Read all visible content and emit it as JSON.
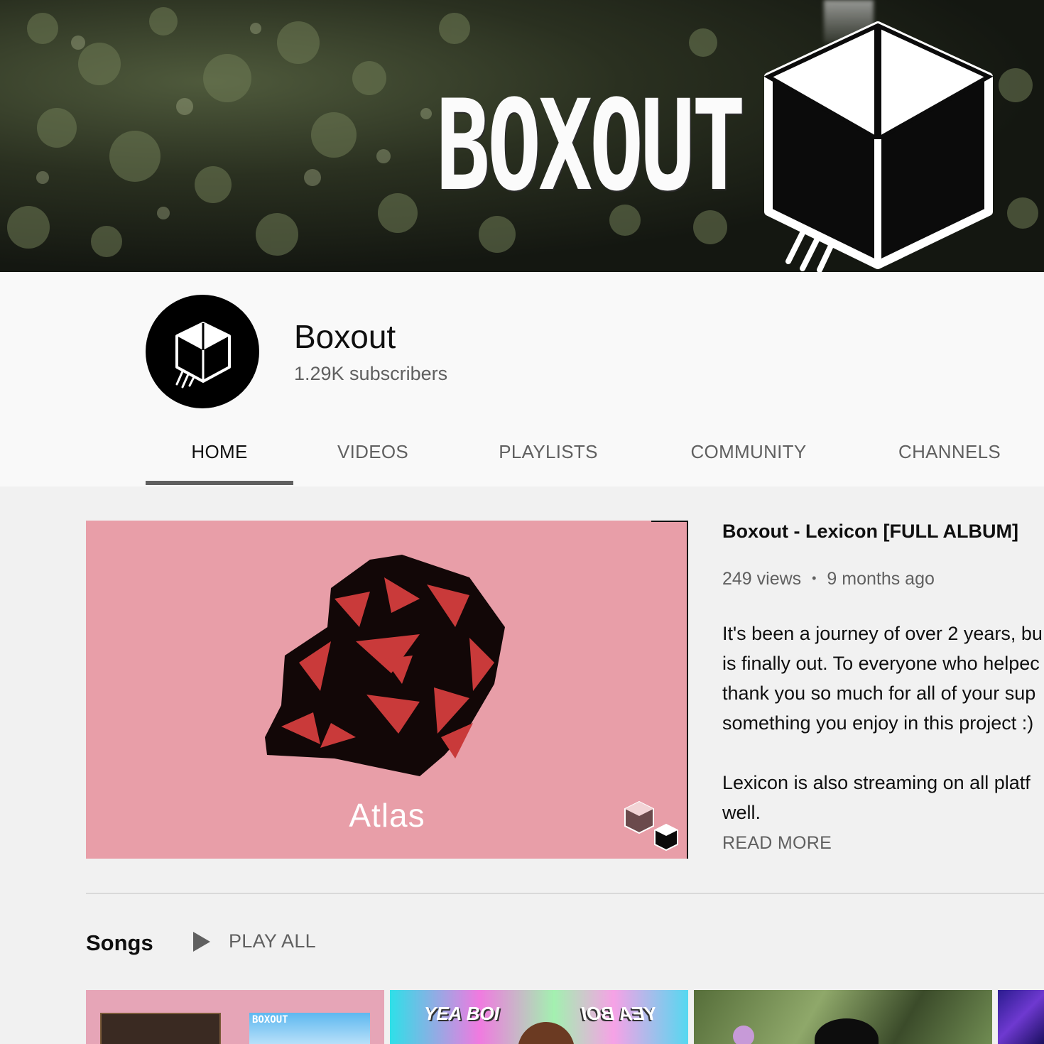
{
  "banner": {
    "wordmark": "BOXOUT"
  },
  "channel": {
    "name": "Boxout",
    "subscribers": "1.29K subscribers"
  },
  "tabs": [
    {
      "label": "HOME",
      "active": true
    },
    {
      "label": "VIDEOS",
      "active": false
    },
    {
      "label": "PLAYLISTS",
      "active": false
    },
    {
      "label": "COMMUNITY",
      "active": false
    },
    {
      "label": "CHANNELS",
      "active": false
    }
  ],
  "featured": {
    "thumbnail_text": "Atlas",
    "title": "Boxout - Lexicon [FULL ALBUM]",
    "views": "249 views",
    "separator": "•",
    "age": "9 months ago",
    "description_lines": [
      "It's been a journey of over 2 years, bu",
      "is finally out. To everyone who helpec",
      "thank you so much for all of your sup",
      "something you enjoy in this project :)",
      "",
      "Lexicon is also streaming on all platf",
      "well."
    ],
    "read_more": "READ MORE"
  },
  "songs": {
    "title": "Songs",
    "play_all": "PLAY ALL",
    "thumb_texts": {
      "s1": "BOXOUT",
      "s2_left": "YEA BOI",
      "s2_right": "YEA BOI"
    }
  },
  "colors": {
    "featured_bg": "#e89ea8",
    "rose_red": "#c93a3a",
    "text_secondary": "#606060"
  }
}
